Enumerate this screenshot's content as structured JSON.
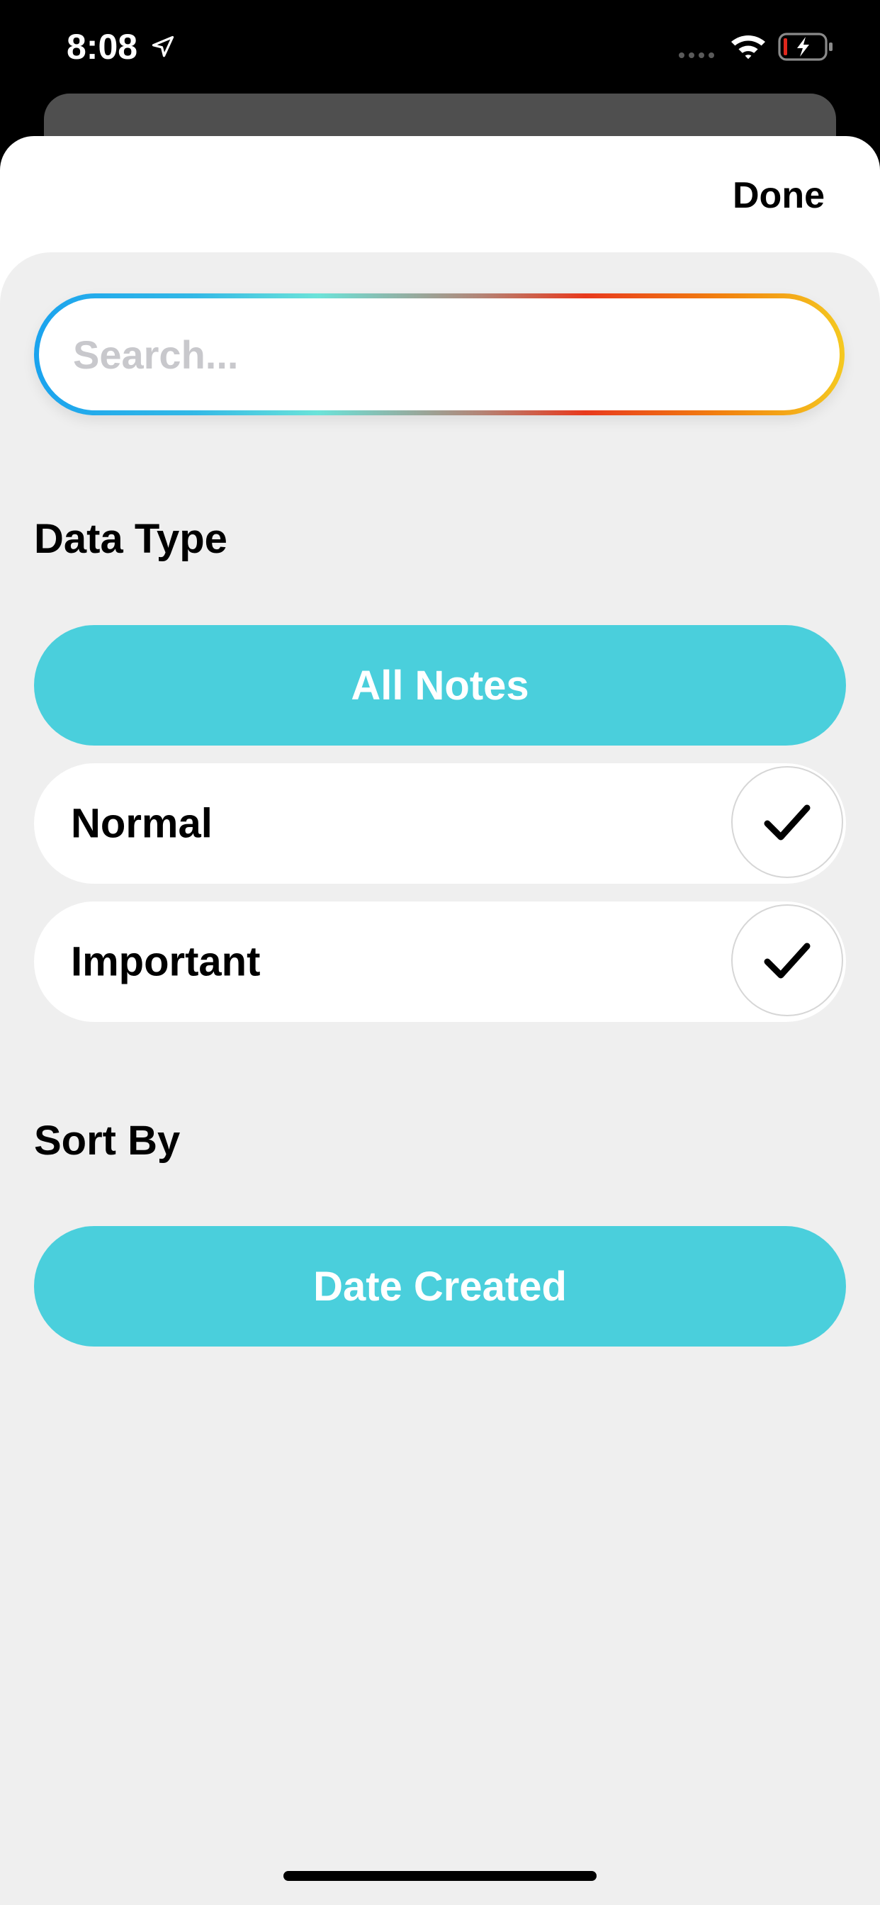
{
  "status_bar": {
    "time": "8:08",
    "icons": [
      "location-arrow-icon",
      "cellular-signal-icon",
      "wifi-icon",
      "battery-charging-icon"
    ]
  },
  "sheet": {
    "done_label": "Done"
  },
  "search": {
    "placeholder": "Search..."
  },
  "data_type": {
    "title": "Data Type",
    "selected_label": "All Notes",
    "options": [
      {
        "label": "Normal",
        "checked": true
      },
      {
        "label": "Important",
        "checked": true
      }
    ]
  },
  "sort_by": {
    "title": "Sort By",
    "selected_label": "Date Created"
  },
  "colors": {
    "accent": "#4acfdc",
    "sheet_background": "#efefef",
    "search_gradient": [
      "#1aa3ee",
      "#6be3d9",
      "#e8391d",
      "#f2820f",
      "#f5c920"
    ]
  }
}
